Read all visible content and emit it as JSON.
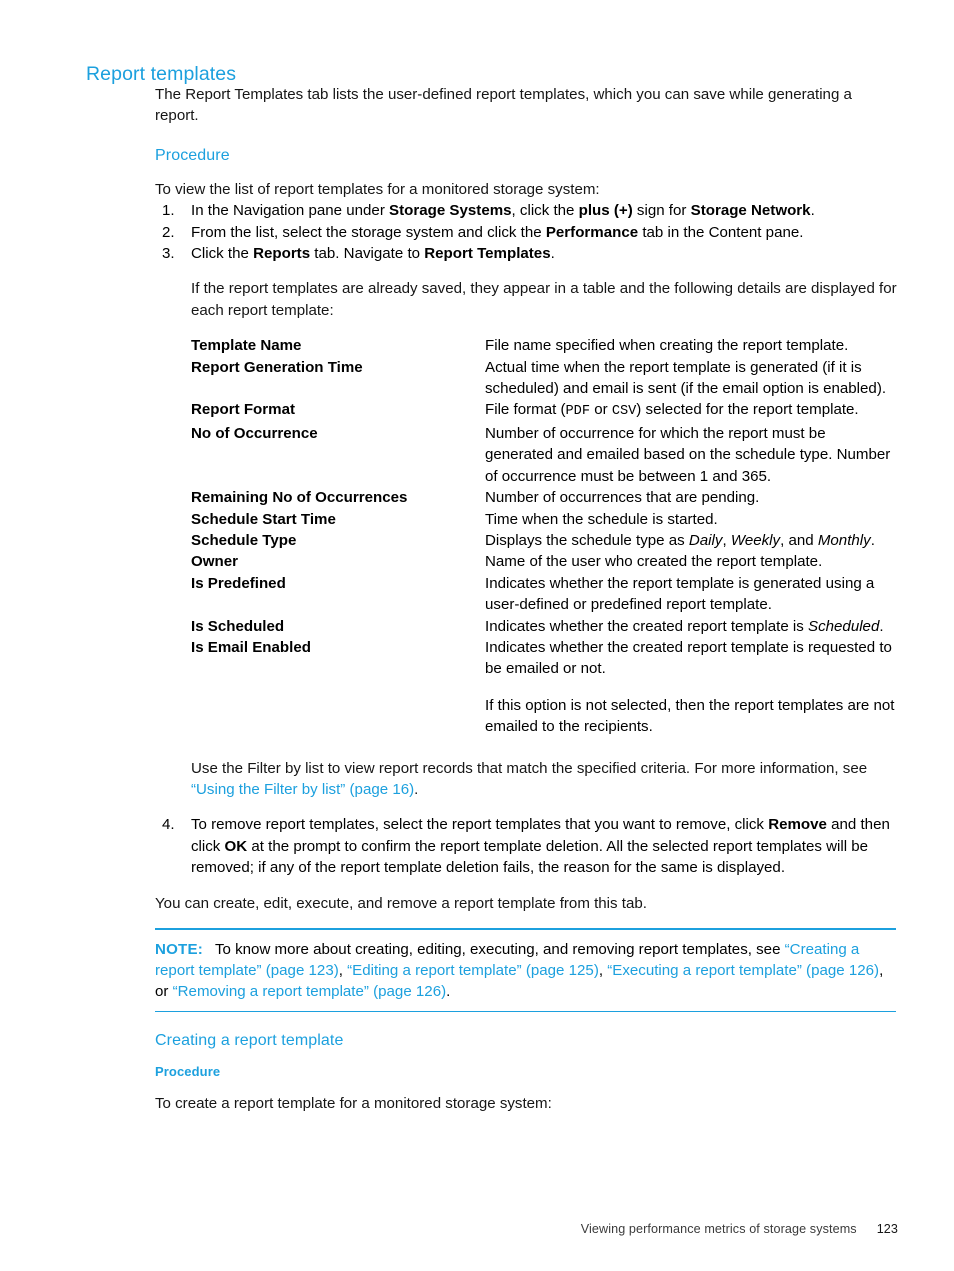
{
  "page": {
    "title": "Report templates",
    "footer_text": "Viewing performance metrics of storage systems",
    "footer_page_number": "123",
    "accent_color": "#1CA0DE",
    "text_color": "#161616"
  },
  "intro": {
    "paragraph": "The Report Templates tab lists the user-defined report templates, which you can save while generating a report."
  },
  "procedure_heading": "Procedure",
  "lead_in": "To view the list of report templates for a monitored storage system:",
  "steps": [
    {
      "number": "1.",
      "parts": [
        {
          "text": "In the Navigation pane under ",
          "style": "normal"
        },
        {
          "text": "Storage Systems",
          "style": "bold"
        },
        {
          "text": ", click the ",
          "style": "normal"
        },
        {
          "text": "plus (+)",
          "style": "bold"
        },
        {
          "text": " sign for ",
          "style": "normal"
        },
        {
          "text": "Storage Network",
          "style": "bold"
        },
        {
          "text": ".",
          "style": "normal"
        }
      ]
    },
    {
      "number": "2.",
      "parts": [
        {
          "text": "From the list, select the storage system and click the ",
          "style": "normal"
        },
        {
          "text": "Performance",
          "style": "bold"
        },
        {
          "text": " tab in the Content pane.",
          "style": "normal"
        }
      ]
    },
    {
      "number": "3.",
      "parts": [
        {
          "text": "Click the ",
          "style": "normal"
        },
        {
          "text": "Reports",
          "style": "bold"
        },
        {
          "text": " tab. Navigate to ",
          "style": "normal"
        },
        {
          "text": "Report Templates",
          "style": "bold"
        },
        {
          "text": ".",
          "style": "normal"
        }
      ]
    }
  ],
  "step3_note": "If the report templates are already saved, they appear in a table and the following details are displayed for each report template:",
  "definitions": [
    {
      "term": "Template Name",
      "desc_parts": [
        {
          "text": "File name specified when creating the report template.",
          "style": "normal"
        }
      ]
    },
    {
      "term": "Report Generation Time",
      "desc_parts": [
        {
          "text": "Actual time when the report template is generated (if it is scheduled) and email is sent (if the email option is enabled).",
          "style": "normal"
        }
      ]
    },
    {
      "term": "Report Format",
      "desc_parts": [
        {
          "text": "File format (",
          "style": "normal"
        },
        {
          "text": "PDF",
          "style": "mono"
        },
        {
          "text": " or ",
          "style": "normal"
        },
        {
          "text": "CSV",
          "style": "mono"
        },
        {
          "text": ") selected for the report template.",
          "style": "normal"
        }
      ]
    },
    {
      "term": "No of Occurrence",
      "desc_parts": [
        {
          "text": "Number of occurrence for which the report must be generated and emailed based on the schedule type. Number of occurrence must be between 1 and 365.",
          "style": "normal"
        }
      ]
    },
    {
      "term": "Remaining No of Occurrences",
      "desc_parts": [
        {
          "text": "Number of occurrences that are pending.",
          "style": "normal"
        }
      ]
    },
    {
      "term": "Schedule Start Time",
      "desc_parts": [
        {
          "text": "Time when the schedule is started.",
          "style": "normal"
        }
      ]
    },
    {
      "term": "Schedule Type",
      "desc_parts": [
        {
          "text": "Displays the schedule type as ",
          "style": "normal"
        },
        {
          "text": "Daily",
          "style": "italic"
        },
        {
          "text": ", ",
          "style": "normal"
        },
        {
          "text": "Weekly",
          "style": "italic"
        },
        {
          "text": ", and ",
          "style": "normal"
        },
        {
          "text": "Monthly",
          "style": "italic"
        },
        {
          "text": ".",
          "style": "normal"
        }
      ]
    },
    {
      "term": "Owner",
      "desc_parts": [
        {
          "text": "Name of the user who created the report template.",
          "style": "normal"
        }
      ]
    },
    {
      "term": "Is Predefined",
      "desc_parts": [
        {
          "text": "Indicates whether the report template is generated using a user-defined or predefined report template.",
          "style": "normal"
        }
      ]
    },
    {
      "term": "Is Scheduled",
      "desc_parts": [
        {
          "text": "Indicates whether the created report template is ",
          "style": "normal"
        },
        {
          "text": "Scheduled",
          "style": "italic"
        },
        {
          "text": ".",
          "style": "normal"
        }
      ]
    },
    {
      "term": "Is Email Enabled",
      "desc_parts": [
        {
          "text": "Indicates whether the created report template is requested to be emailed or not.",
          "style": "normal"
        }
      ],
      "desc_parts_2": [
        {
          "text": "If this option is not selected, then the report templates are not emailed to the recipients.",
          "style": "normal"
        }
      ]
    }
  ],
  "filter_paragraph": [
    {
      "text": "Use the Filter by list to view report records that match the specified criteria. For more information, see ",
      "style": "normal"
    },
    {
      "text": "“Using the Filter by list” (page 16)",
      "style": "link"
    },
    {
      "text": ".",
      "style": "normal"
    }
  ],
  "step4": {
    "number": "4.",
    "parts": [
      {
        "text": "To remove report templates, select the report templates that you want to remove, click ",
        "style": "normal"
      },
      {
        "text": "Remove",
        "style": "bold"
      },
      {
        "text": " and then click ",
        "style": "normal"
      },
      {
        "text": "OK",
        "style": "bold"
      },
      {
        "text": " at the prompt to confirm the report template deletion. All the selected report templates will be removed; if any of the report template deletion fails, the reason for the same is displayed.",
        "style": "normal"
      }
    ]
  },
  "closing_paragraph": "You can create, edit, execute, and remove a report template from this tab.",
  "note": {
    "label": "NOTE:",
    "parts": [
      {
        "text": "To know more about creating, editing, executing, and removing report templates, see ",
        "style": "normal"
      },
      {
        "text": "“Creating a report template” (page 123)",
        "style": "link"
      },
      {
        "text": ", ",
        "style": "normal"
      },
      {
        "text": "“Editing a report template” (page 125)",
        "style": "link"
      },
      {
        "text": ", ",
        "style": "normal"
      },
      {
        "text": "“Executing a report template” (page 126)",
        "style": "link"
      },
      {
        "text": ", or ",
        "style": "normal"
      },
      {
        "text": "“Removing a report template” (page 126)",
        "style": "link"
      },
      {
        "text": ".",
        "style": "normal"
      }
    ]
  },
  "section2": {
    "heading": "Creating a report template",
    "procedure_heading": "Procedure",
    "lead_in": "To create a report template for a monitored storage system:"
  }
}
